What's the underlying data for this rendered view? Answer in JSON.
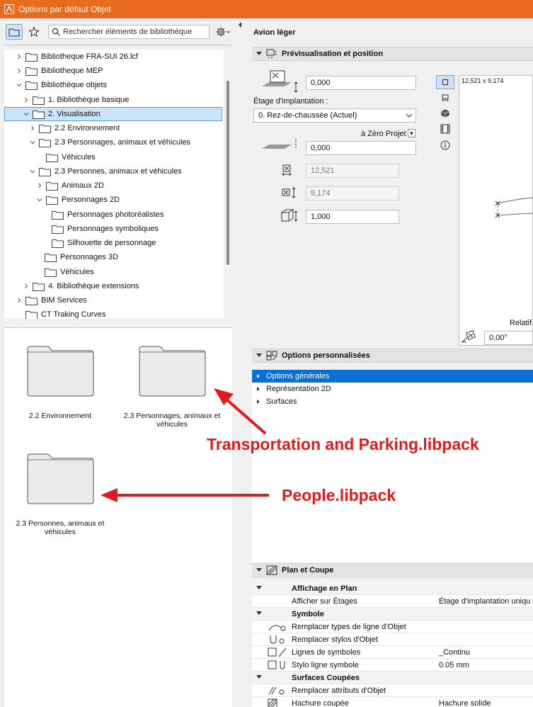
{
  "window": {
    "title": "Options par défaut Objet"
  },
  "library": {
    "search_placeholder": "Rechercher éléments de bibliothèque",
    "tree": [
      {
        "label": "Bibliotheque FRA-SUI 26.lcf"
      },
      {
        "label": "Bibliotheque MEP"
      },
      {
        "label": "Bibliothèque objets"
      },
      {
        "label": "1. Bibliothèque basique"
      },
      {
        "label": "2. Visualisation"
      },
      {
        "label": "2.2 Environnement"
      },
      {
        "label": "2.3 Personnages, animaux et véhicules"
      },
      {
        "label": "Véhicules"
      },
      {
        "label": "2.3 Personnes, animaux et véhicules"
      },
      {
        "label": "Animaux 2D"
      },
      {
        "label": "Personnages 2D"
      },
      {
        "label": "Personnages photoréalistes"
      },
      {
        "label": "Personnages symboliques"
      },
      {
        "label": "Silhouette de personnage"
      },
      {
        "label": "Personnages 3D"
      },
      {
        "label": "Véhicules"
      },
      {
        "label": "4. Bibliothèque extensions"
      },
      {
        "label": "BIM Services"
      },
      {
        "label": "CT Traking Curves"
      }
    ],
    "thumbnails": [
      {
        "label": "2.2 Environnement"
      },
      {
        "label": "2.3 Personnages, animaux et véhicules"
      },
      {
        "label": "2.3 Personnes, animaux et véhicules"
      }
    ]
  },
  "settings": {
    "object_name": "Avion léger",
    "preview_section": {
      "title": "Prévisualisation et position",
      "elevation_value": "0,000",
      "story_label": "Étage d'implantation :",
      "story_value": "0. Rez-de-chaussée (Actuel)",
      "zero_label": "à Zéro Projet",
      "zero_value": "0,000",
      "width_value": "12,521",
      "depth_value": "9,174",
      "height_value": "1,000",
      "preview_size": "12,521 x 9,174",
      "relatif_label": "Relatif",
      "angle_value": "0,00°"
    },
    "custom_section": {
      "title": "Options personnalisées",
      "items": [
        {
          "label": "Options générales"
        },
        {
          "label": "Représentation 2D"
        },
        {
          "label": "Surfaces"
        }
      ]
    },
    "plan_section": {
      "title": "Plan et Coupe",
      "rows": [
        {
          "name": "Affichage en Plan",
          "value": ""
        },
        {
          "name": "Afficher sur Étages",
          "value": "Étage d'implantation uniqu"
        },
        {
          "name": "Symbole",
          "value": ""
        },
        {
          "name": "Remplacer types de ligne d'Objet",
          "value": ""
        },
        {
          "name": "Remplacer stylos d'Objet",
          "value": ""
        },
        {
          "name": "Lignes de symboles",
          "value": "_Continu"
        },
        {
          "name": "Stylo ligne symbole",
          "value": "0.05 mm"
        },
        {
          "name": "Surfaces Coupées",
          "value": ""
        },
        {
          "name": "Remplacer attributs d'Objet",
          "value": ""
        },
        {
          "name": "Hachure coupée",
          "value": "Hachure solide"
        }
      ]
    }
  },
  "annotations": {
    "transport": "Transportation and Parking.libpack",
    "people": "People.libpack",
    "color": "#e01b1b"
  },
  "colors": {
    "titlebar": "#e86a1a",
    "selection": "#0a6fd2"
  }
}
